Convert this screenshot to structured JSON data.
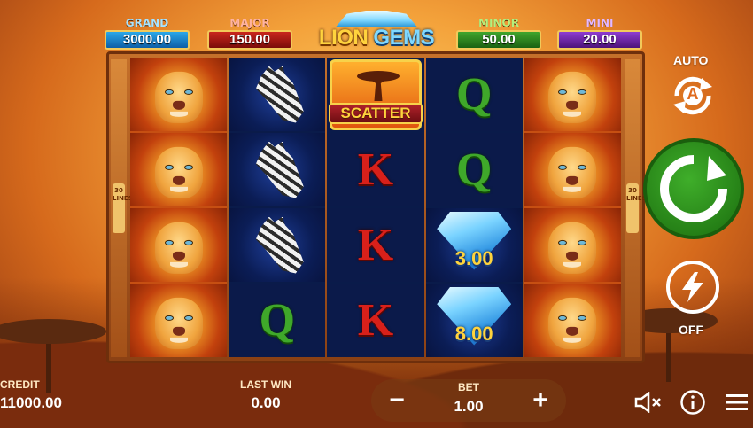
{
  "jackpots": [
    {
      "label": "GRAND",
      "value": "3000.00"
    },
    {
      "label": "MAJOR",
      "value": "150.00"
    },
    {
      "label": "MINOR",
      "value": "50.00"
    },
    {
      "label": "MINI",
      "value": "20.00"
    }
  ],
  "logo": {
    "word1": "LION",
    "word2": "GEMS"
  },
  "lines_tag": "30 LINES",
  "reels": [
    [
      "lion",
      "lion",
      "lion",
      "lion"
    ],
    [
      "zebra",
      "zebra",
      "zebra",
      "Q"
    ],
    [
      "scatter",
      "K",
      "K",
      "K"
    ],
    [
      "Q",
      "Q",
      "diamond",
      "diamond"
    ],
    [
      "lion",
      "lion",
      "lion",
      "lion"
    ]
  ],
  "scatter_label": "SCATTER",
  "letters": {
    "q": "Q",
    "k": "K"
  },
  "diamond_values": [
    "3.00",
    "8.00"
  ],
  "controls": {
    "auto_label": "AUTO",
    "auto_glyph": "A",
    "turbo_label": "OFF",
    "spin_color": "#2f9a1f"
  },
  "bottom": {
    "credit_label": "CREDIT",
    "credit_value": "11000.00",
    "last_win_label": "LAST WIN",
    "last_win_value": "0.00",
    "bet_label": "BET",
    "bet_value": "1.00",
    "minus": "−",
    "plus": "+"
  },
  "icons": [
    "sound-off-icon",
    "info-icon",
    "menu-icon"
  ]
}
